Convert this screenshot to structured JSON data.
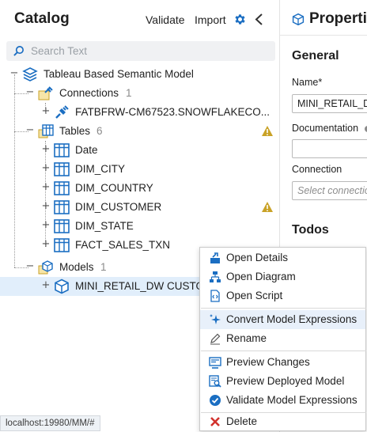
{
  "catalog": {
    "title": "Catalog",
    "validate": "Validate",
    "import": "Import",
    "search_placeholder": "Search Text"
  },
  "tree": {
    "root": "Tableau Based Semantic Model",
    "connections": {
      "label": "Connections",
      "count": "1"
    },
    "connection_item": "FATBFRW-CM67523.SNOWFLAKECO...",
    "tables": {
      "label": "Tables",
      "count": "6"
    },
    "table_items": [
      "Date",
      "DIM_CITY",
      "DIM_COUNTRY",
      "DIM_CUSTOMER",
      "DIM_STATE",
      "FACT_SALES_TXN"
    ],
    "models": {
      "label": "Models",
      "count": "1"
    },
    "model_item": "MINI_RETAIL_DW CUSTO"
  },
  "properties": {
    "title": "Properties",
    "general": "General",
    "name_label": "Name*",
    "name_value": "MINI_RETAIL_D",
    "documentation_label": "Documentation",
    "connection_label": "Connection",
    "connection_placeholder": "Select connection",
    "todos": "Todos"
  },
  "context_menu": {
    "items": [
      "Open Details",
      "Open Diagram",
      "Open Script",
      "Convert Model Expressions",
      "Rename",
      "Preview Changes",
      "Preview Deployed Model",
      "Validate Model Expressions",
      "Delete"
    ]
  },
  "status_bar": "localhost:19980/MM/#",
  "colors": {
    "accent": "#1b6ec2",
    "warning": "#c9a227",
    "delete": "#d2322d",
    "selected_row": "#e1eefb",
    "menu_highlight": "#e8f0fa"
  }
}
